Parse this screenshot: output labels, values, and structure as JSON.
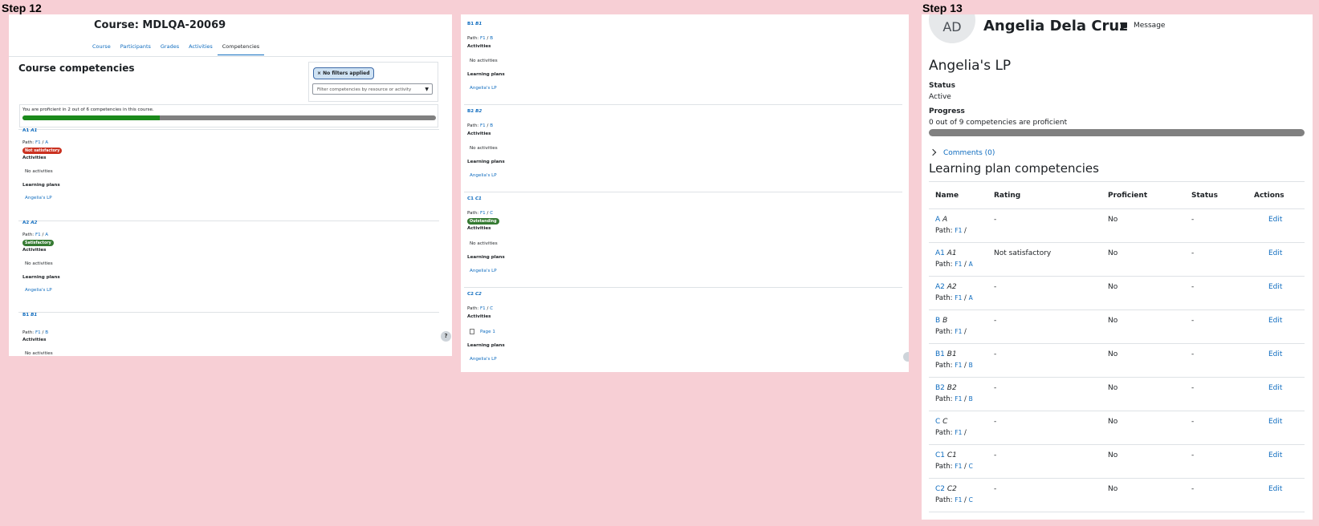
{
  "steps": {
    "step12": "Step 12",
    "step13": "Step 13"
  },
  "panel1": {
    "course_title": "Course: MDLQA-20069",
    "tabs": [
      "Course",
      "Participants",
      "Grades",
      "Activities",
      "Competencies"
    ],
    "section_title": "Course competencies",
    "filter_badge": "× No filters applied",
    "filter_placeholder": "Filter competencies by resource or activity",
    "proficiency_text": "You are proficient in 2 out of 6 competencies in this course.",
    "proficiency_fraction": 0.333,
    "competencies": [
      {
        "code": "A1",
        "name": "A1",
        "path_prefix": "Path:",
        "path": [
          "F1",
          "A"
        ],
        "badge": "Not satisfactory",
        "badge_color": "#ca3120",
        "activities_label": "Activities",
        "activities": "No activities",
        "plans_label": "Learning plans",
        "plan": "Angelia's LP"
      },
      {
        "code": "A2",
        "name": "A2",
        "path_prefix": "Path:",
        "path": [
          "F1",
          "A"
        ],
        "badge": "Satisfactory",
        "badge_color": "#357a32",
        "activities_label": "Activities",
        "activities": "No activities",
        "plans_label": "Learning plans",
        "plan": "Angelia's LP"
      },
      {
        "code": "B1",
        "name": "B1",
        "path_prefix": "Path:",
        "path": [
          "F1",
          "B"
        ],
        "activities_label": "Activities",
        "activities": "No activities"
      }
    ],
    "help": "?"
  },
  "panel2": {
    "competencies": [
      {
        "code": "B1",
        "name": "B1",
        "path_prefix": "Path:",
        "path": [
          "F1",
          "B"
        ],
        "activities_label": "Activities",
        "activities": "No activities",
        "plans_label": "Learning plans",
        "plan": "Angelia's LP"
      },
      {
        "code": "B2",
        "name": "B2",
        "path_prefix": "Path:",
        "path": [
          "F1",
          "B"
        ],
        "activities_label": "Activities",
        "activities": "No activities",
        "plans_label": "Learning plans",
        "plan": "Angelia's LP"
      },
      {
        "code": "C1",
        "name": "C1",
        "path_prefix": "Path:",
        "path": [
          "F1",
          "C"
        ],
        "badge": "Outstanding",
        "badge_color": "#357a32",
        "activities_label": "Activities",
        "activities": "No activities",
        "plans_label": "Learning plans",
        "plan": "Angelia's LP"
      },
      {
        "code": "C2",
        "name": "C2",
        "path_prefix": "Path:",
        "path": [
          "F1",
          "C"
        ],
        "activities_label": "Activities",
        "activities": "Page 1",
        "plans_label": "Learning plans",
        "plan": "Angelia's LP"
      }
    ]
  },
  "panel3": {
    "avatar_initials": "AD",
    "user_name": "Angelia Dela Cruz",
    "message_label": "Message",
    "plan_title": "Angelia's LP",
    "status_label": "Status",
    "status_value": "Active",
    "progress_label": "Progress",
    "progress_text": "0 out of 9 competencies are proficient",
    "progress_fraction": 0,
    "comments_label": "Comments (0)",
    "table_title": "Learning plan competencies",
    "columns": [
      "Name",
      "Rating",
      "Proficient",
      "Status",
      "Actions"
    ],
    "rows": [
      {
        "code": "A",
        "name": "A",
        "path": [
          "F1"
        ],
        "rating": "-",
        "proficient": "No",
        "status": "-",
        "action": "Edit"
      },
      {
        "code": "A1",
        "name": "A1",
        "path": [
          "F1",
          "A"
        ],
        "rating": "Not satisfactory",
        "proficient": "No",
        "status": "-",
        "action": "Edit"
      },
      {
        "code": "A2",
        "name": "A2",
        "path": [
          "F1",
          "A"
        ],
        "rating": "-",
        "proficient": "No",
        "status": "-",
        "action": "Edit"
      },
      {
        "code": "B",
        "name": "B",
        "path": [
          "F1"
        ],
        "rating": "-",
        "proficient": "No",
        "status": "-",
        "action": "Edit"
      },
      {
        "code": "B1",
        "name": "B1",
        "path": [
          "F1",
          "B"
        ],
        "rating": "-",
        "proficient": "No",
        "status": "-",
        "action": "Edit"
      },
      {
        "code": "B2",
        "name": "B2",
        "path": [
          "F1",
          "B"
        ],
        "rating": "-",
        "proficient": "No",
        "status": "-",
        "action": "Edit"
      },
      {
        "code": "C",
        "name": "C",
        "path": [
          "F1"
        ],
        "rating": "-",
        "proficient": "No",
        "status": "-",
        "action": "Edit"
      },
      {
        "code": "C1",
        "name": "C1",
        "path": [
          "F1",
          "C"
        ],
        "rating": "-",
        "proficient": "No",
        "status": "-",
        "action": "Edit"
      },
      {
        "code": "C2",
        "name": "C2",
        "path": [
          "F1",
          "C"
        ],
        "rating": "-",
        "proficient": "No",
        "status": "-",
        "action": "Edit"
      }
    ],
    "path_prefix": "Path:"
  }
}
